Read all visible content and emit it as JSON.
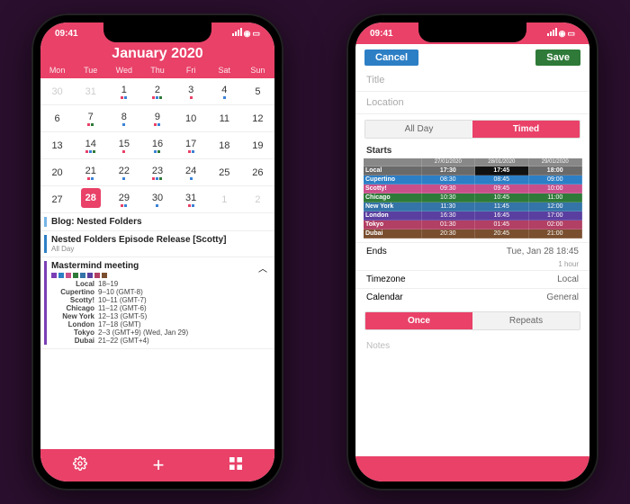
{
  "status_time": "09:41",
  "left": {
    "title": "January 2020",
    "dow": [
      "Mon",
      "Tue",
      "Wed",
      "Thu",
      "Fri",
      "Sat",
      "Sun"
    ],
    "days": [
      {
        "n": 30,
        "dim": true
      },
      {
        "n": 31,
        "dim": true
      },
      {
        "n": 1,
        "dots": [
          "#e94168",
          "#3b82d6"
        ]
      },
      {
        "n": 2,
        "dots": [
          "#e94168",
          "#3b82d6",
          "#2f7a39"
        ]
      },
      {
        "n": 3,
        "dots": [
          "#e94168"
        ]
      },
      {
        "n": 4,
        "dots": [
          "#3b82d6"
        ]
      },
      {
        "n": 5
      },
      {
        "n": 6
      },
      {
        "n": 7,
        "dots": [
          "#e94168",
          "#2f7a39"
        ]
      },
      {
        "n": 8,
        "dots": [
          "#3b82d6"
        ]
      },
      {
        "n": 9,
        "dots": [
          "#e94168",
          "#3b82d6"
        ]
      },
      {
        "n": 10
      },
      {
        "n": 11
      },
      {
        "n": 12
      },
      {
        "n": 13
      },
      {
        "n": 14,
        "dots": [
          "#e94168",
          "#3b82d6",
          "#2f7a39"
        ]
      },
      {
        "n": 15,
        "dots": [
          "#e94168"
        ]
      },
      {
        "n": 16,
        "dots": [
          "#3b82d6",
          "#2f7a39"
        ]
      },
      {
        "n": 17,
        "dots": [
          "#e94168",
          "#3b82d6"
        ]
      },
      {
        "n": 18
      },
      {
        "n": 19
      },
      {
        "n": 20
      },
      {
        "n": 21,
        "dots": [
          "#e94168",
          "#3b82d6"
        ]
      },
      {
        "n": 22,
        "dots": [
          "#3b82d6"
        ]
      },
      {
        "n": 23,
        "dots": [
          "#e94168",
          "#3b82d6",
          "#2f7a39"
        ]
      },
      {
        "n": 24,
        "dots": [
          "#3b82d6"
        ]
      },
      {
        "n": 25
      },
      {
        "n": 26
      },
      {
        "n": 27
      },
      {
        "n": 28,
        "sel": true,
        "dots": [
          "#fff"
        ]
      },
      {
        "n": 29,
        "dots": [
          "#e94168",
          "#3b82d6"
        ]
      },
      {
        "n": 30,
        "dots": [
          "#3b82d6"
        ]
      },
      {
        "n": 31,
        "dots": [
          "#e94168",
          "#3b82d6"
        ]
      },
      {
        "n": 1,
        "dim": true
      },
      {
        "n": 2,
        "dim": true
      }
    ],
    "events": [
      {
        "bar": "#76b5e6",
        "title": "Blog: Nested Folders",
        "sub": ""
      },
      {
        "bar": "#2d7fc5",
        "title": "Nested Folders Episode Release [Scotty]",
        "sub": "All Day"
      }
    ],
    "mastermind": {
      "title": "Mastermind meeting",
      "colors": [
        "#7b3fb5",
        "#2d7fc5",
        "#c94f8b",
        "#2f7a39",
        "#3474a8",
        "#5a3fa0",
        "#b23f64",
        "#7a4f2f"
      ],
      "rows": [
        {
          "tz": "Local",
          "txt": "18–19"
        },
        {
          "tz": "Cupertino",
          "txt": "9–10 (GMT-8)"
        },
        {
          "tz": "Scotty!",
          "txt": "10–11 (GMT-7)"
        },
        {
          "tz": "Chicago",
          "txt": "11–12 (GMT-6)"
        },
        {
          "tz": "New York",
          "txt": "12–13 (GMT-5)"
        },
        {
          "tz": "London",
          "txt": "17–18 (GMT)"
        },
        {
          "tz": "Tokyo",
          "txt": "2–3 (GMT+9) (Wed, Jan 29)"
        },
        {
          "tz": "Dubai",
          "txt": "21–22 (GMT+4)"
        }
      ]
    }
  },
  "right": {
    "cancel": "Cancel",
    "save": "Save",
    "title_ph": "Title",
    "location_ph": "Location",
    "seg_allday": "All Day",
    "seg_timed": "Timed",
    "starts": "Starts",
    "grid_header": [
      "",
      "27/01/2020",
      "28/01/2020",
      "29/01/2020"
    ],
    "grid_rows": [
      {
        "name": "Local",
        "bg": "#6a6a6a",
        "c": [
          "17:30",
          "17:45",
          "18:00"
        ]
      },
      {
        "name": "Cupertino",
        "bg": "#2d7fc5",
        "c": [
          "08:30",
          "08:45",
          "09:00"
        ]
      },
      {
        "name": "Scotty!",
        "bg": "#c94f8b",
        "c": [
          "09:30",
          "09:45",
          "10:00"
        ]
      },
      {
        "name": "Chicago",
        "bg": "#2f7a39",
        "c": [
          "10:30",
          "10:45",
          "11:00"
        ]
      },
      {
        "name": "New York",
        "bg": "#3474a8",
        "c": [
          "11:30",
          "11:45",
          "12:00"
        ]
      },
      {
        "name": "London",
        "bg": "#5a3fa0",
        "c": [
          "16:30",
          "16:45",
          "17:00"
        ]
      },
      {
        "name": "Tokyo",
        "bg": "#b23f64",
        "c": [
          "01:30",
          "01:45",
          "02:00"
        ]
      },
      {
        "name": "Dubai",
        "bg": "#7a4f2f",
        "c": [
          "20:30",
          "20:45",
          "21:00"
        ]
      }
    ],
    "ends": "Ends",
    "ends_val": "Tue, Jan 28 18:45",
    "duration": "1 hour",
    "tz_label": "Timezone",
    "tz_val": "Local",
    "cal_label": "Calendar",
    "cal_val": "General",
    "once": "Once",
    "repeats": "Repeats",
    "notes": "Notes"
  }
}
